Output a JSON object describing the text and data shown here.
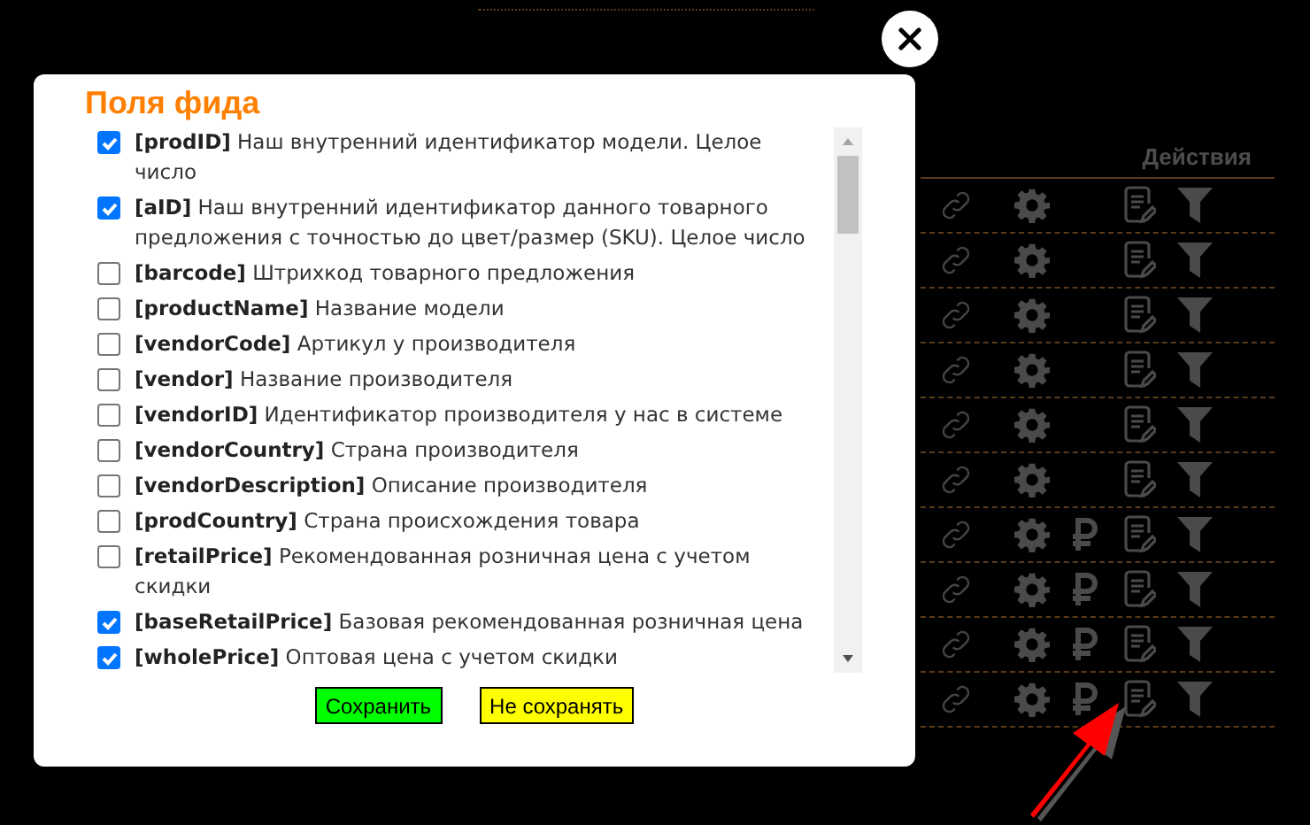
{
  "table": {
    "header": "Действия",
    "rows": [
      {
        "ruble": false
      },
      {
        "ruble": false
      },
      {
        "ruble": false
      },
      {
        "ruble": false
      },
      {
        "ruble": false
      },
      {
        "ruble": false
      },
      {
        "ruble": true
      },
      {
        "ruble": true
      },
      {
        "ruble": true
      },
      {
        "ruble": true
      }
    ]
  },
  "dialog": {
    "title": "Поля фида",
    "fields": [
      {
        "code": "[prodID]",
        "description": "Наш внутренний идентификатор модели. Целое число",
        "checked": true
      },
      {
        "code": "[aID]",
        "description": "Наш внутренний идентификатор данного товарного предложения с точностью до цвет/размер (SKU). Целое число",
        "checked": true
      },
      {
        "code": "[barcode]",
        "description": "Штрихкод товарного предложения",
        "checked": false
      },
      {
        "code": "[productName]",
        "description": "Название модели",
        "checked": false
      },
      {
        "code": "[vendorCode]",
        "description": "Артикул у производителя",
        "checked": false
      },
      {
        "code": "[vendor]",
        "description": "Название производителя",
        "checked": false
      },
      {
        "code": "[vendorID]",
        "description": "Идентификатор производителя у нас в системе",
        "checked": false
      },
      {
        "code": "[vendorCountry]",
        "description": "Страна производителя",
        "checked": false
      },
      {
        "code": "[vendorDescription]",
        "description": "Описание производителя",
        "checked": false
      },
      {
        "code": "[prodCountry]",
        "description": "Страна происхождения товара",
        "checked": false
      },
      {
        "code": "[retailPrice]",
        "description": "Рекомендованная розничная цена с учетом скидки",
        "checked": false
      },
      {
        "code": "[baseRetailPrice]",
        "description": "Базовая рекомендованная розничная цена",
        "checked": true
      },
      {
        "code": "[wholePrice]",
        "description": "Оптовая цена с учетом скидки",
        "checked": true
      }
    ],
    "buttons": [
      {
        "label": "Сохранить",
        "kind": "save"
      },
      {
        "label": "Не сохранять",
        "kind": "cancel"
      }
    ]
  }
}
